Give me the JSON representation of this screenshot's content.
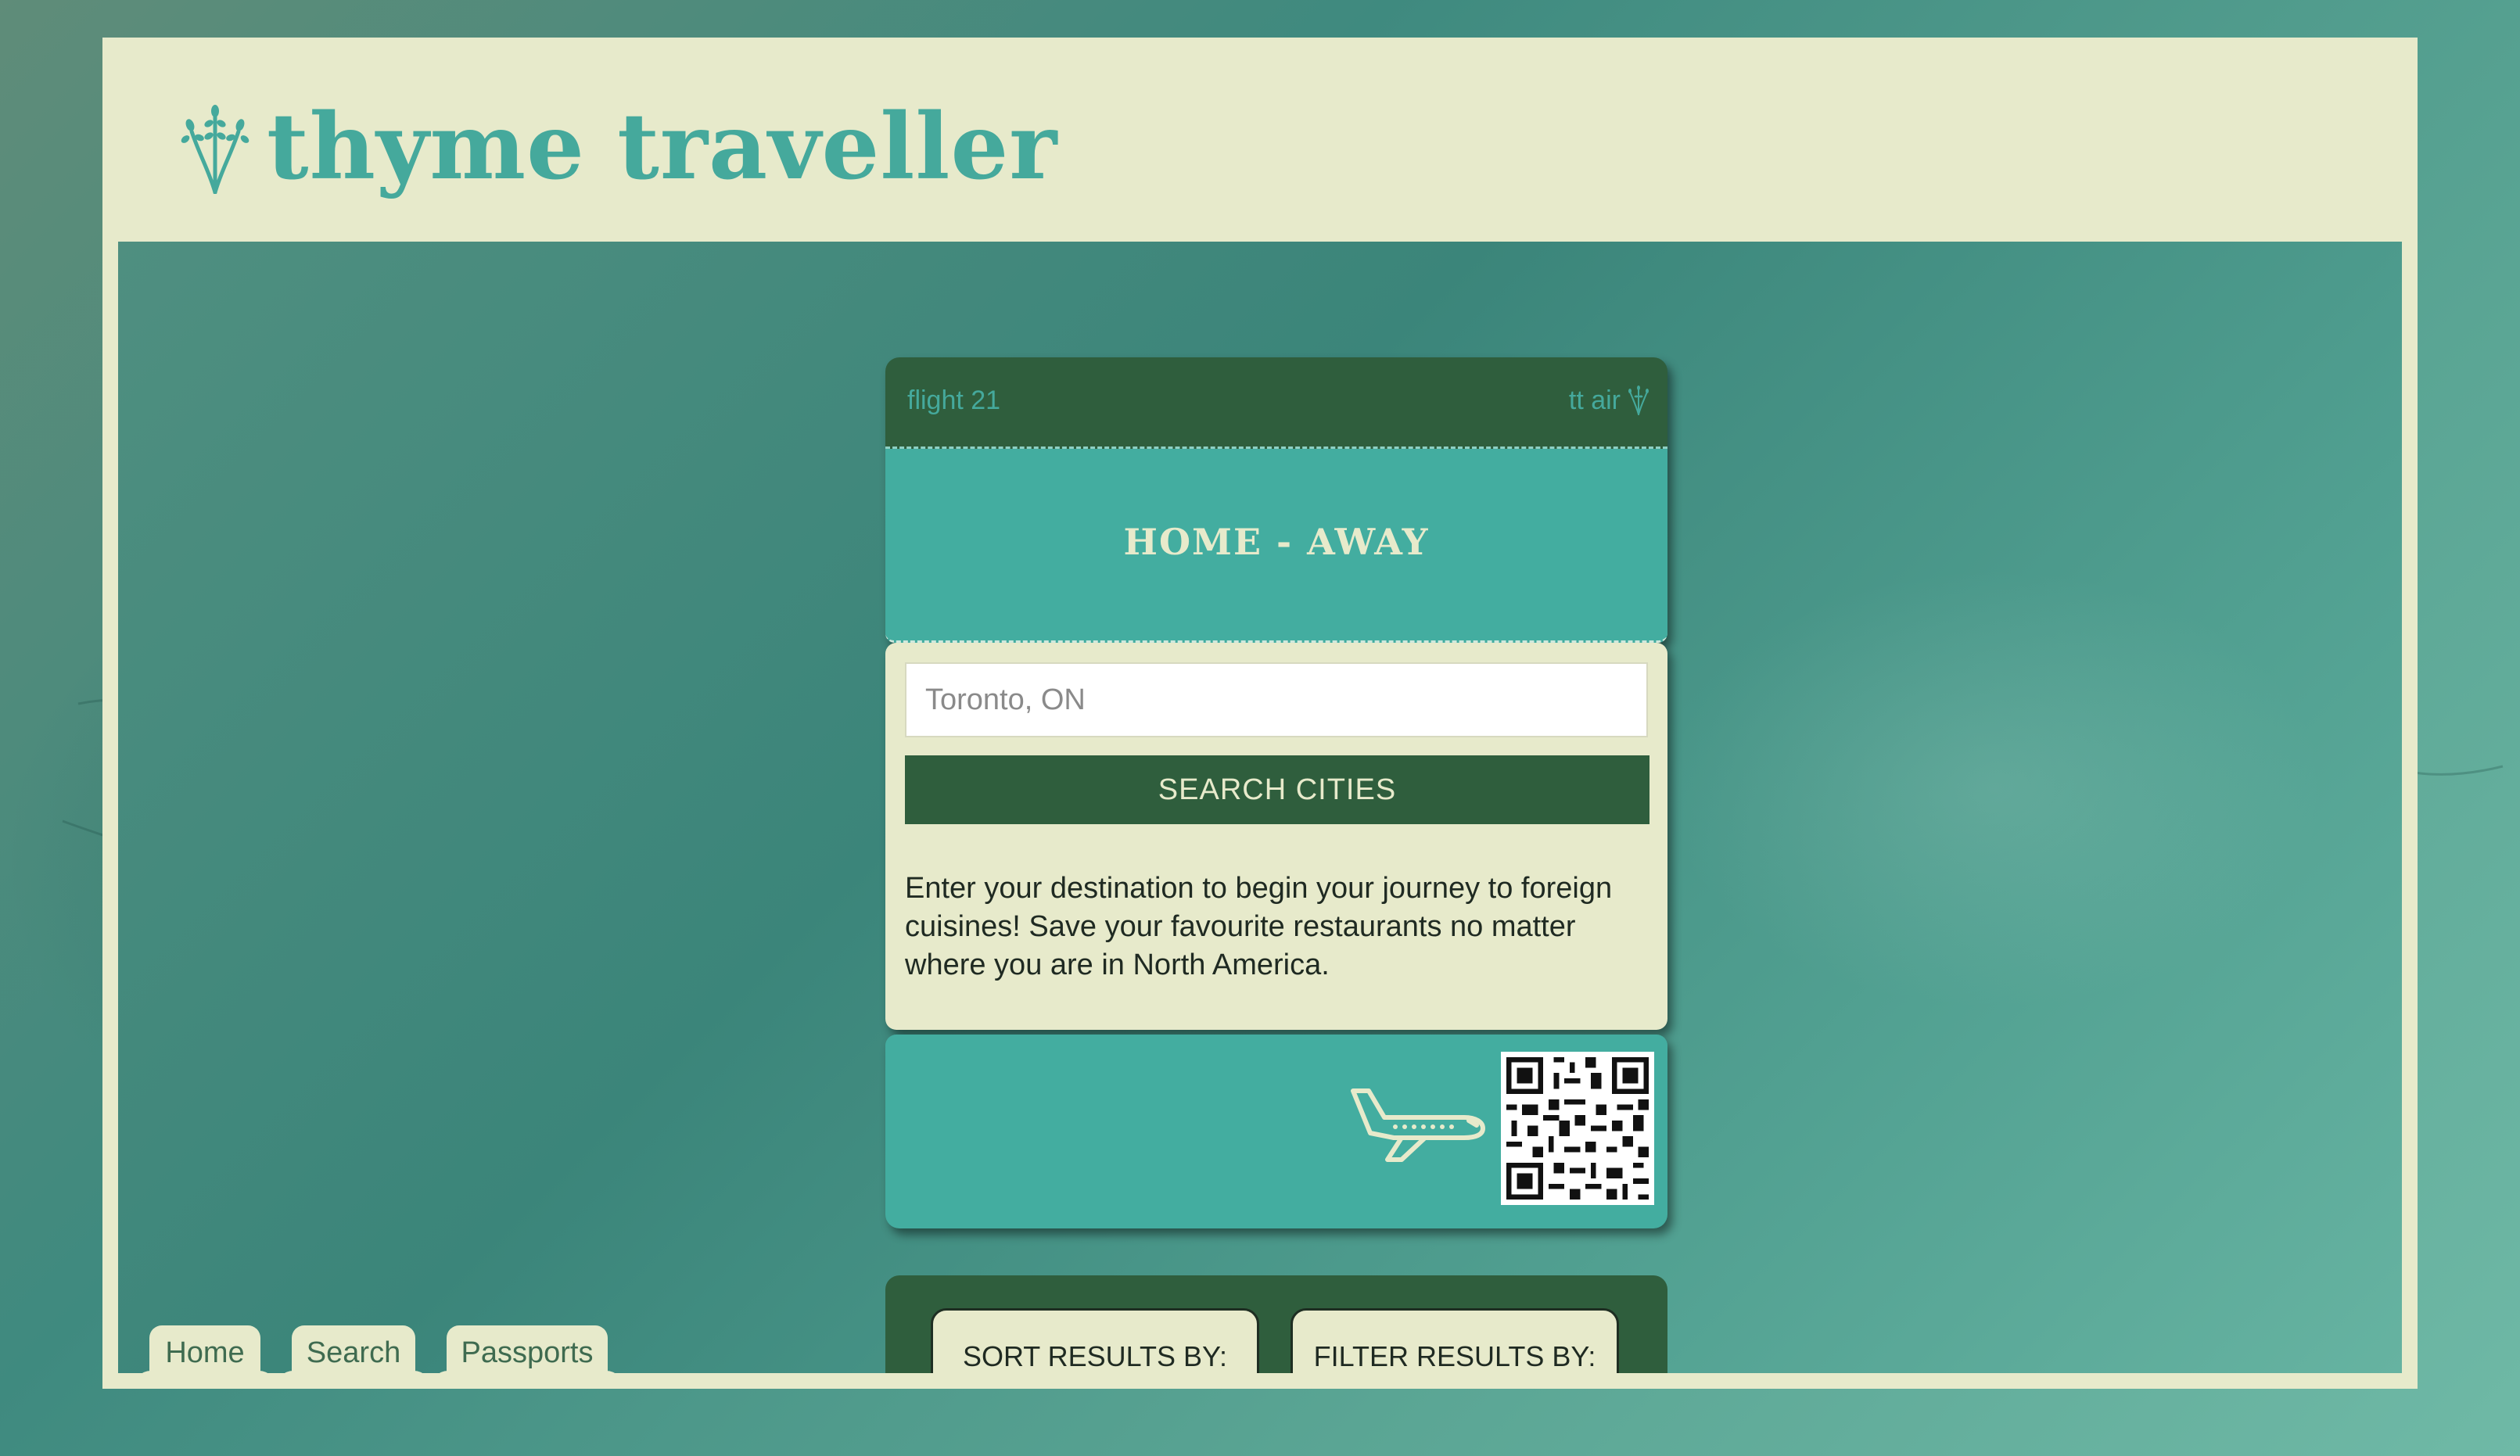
{
  "app": {
    "brand": "thyme traveller",
    "logo_icon": "lavender-sprig-icon"
  },
  "ticket": {
    "flight_label": "flight 21",
    "airline_label": "tt air",
    "airline_icon": "lavender-sprig-icon",
    "route_title": "HOME - AWAY",
    "search": {
      "placeholder": "Toronto, ON",
      "value": ""
    },
    "search_button_label": "SEARCH CITIES",
    "description": "Enter your destination to begin your journey to foreign cuisines! Save your favourite restaurants no matter where you are in North America.",
    "plane_icon": "airplane-icon",
    "qr_icon": "qr-code-icon"
  },
  "results_panel": {
    "sort_label": "SORT RESULTS BY:",
    "filter_label": "FILTER RESULTS BY:"
  },
  "nav": {
    "tabs": [
      {
        "label": "Home"
      },
      {
        "label": "Search"
      },
      {
        "label": "Passports"
      }
    ]
  },
  "colors": {
    "cream": "#e7eacb",
    "teal": "#43ada0",
    "dark_green": "#2f5e3d",
    "brand_teal": "#45a99c"
  }
}
